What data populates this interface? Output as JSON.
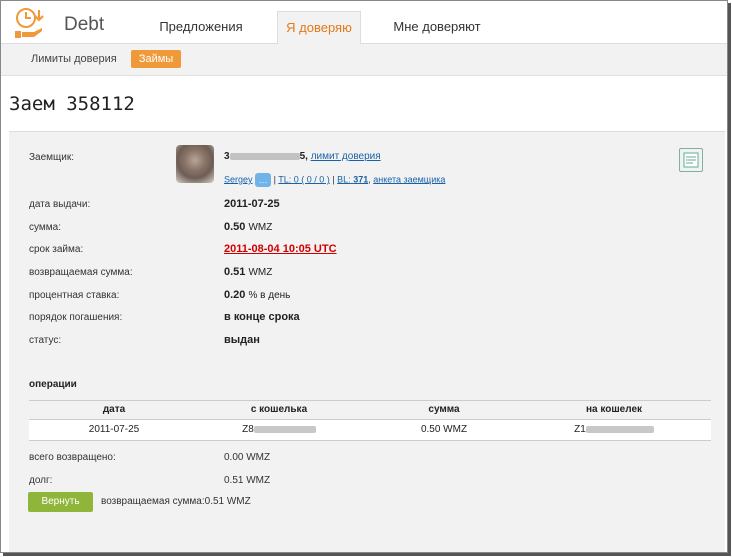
{
  "header": {
    "brand": "Debt",
    "tabs": [
      {
        "label": "Предложения"
      },
      {
        "label": "Я доверяю"
      },
      {
        "label": "Мне доверяют"
      }
    ]
  },
  "subnav": {
    "link_label": "Лимиты доверия",
    "active_label": "Займы"
  },
  "page_title": "Заем 358112",
  "borrower": {
    "label": "Заемщик:",
    "name_prefix": "3",
    "name_suffix": "5,",
    "limit_link": "лимит доверия",
    "user_link": "Sergey",
    "tl_link": "TL: 0 ( 0 / 0 )",
    "bl_prefix": "BL:",
    "bl_value": "371",
    "profile_link": "анкета заемщика"
  },
  "fields": {
    "issue_date": {
      "label": "дата выдачи:",
      "value": "2011-07-25"
    },
    "amount": {
      "label": "сумма:",
      "value": "0.50",
      "unit": "WMZ"
    },
    "term": {
      "label": "срок займа:",
      "value": "2011-08-04 10:05 UTC"
    },
    "return_amount": {
      "label": "возвращаемая сумма:",
      "value": "0.51",
      "unit": "WMZ"
    },
    "rate": {
      "label": "процентная ставка:",
      "value": "0.20",
      "unit": "% в день"
    },
    "repayment": {
      "label": "порядок погашения:",
      "value": "в конце срока"
    },
    "status": {
      "label": "статус:",
      "value": "выдан"
    }
  },
  "operations": {
    "title": "операции",
    "columns": [
      "дата",
      "с кошелька",
      "сумма",
      "на кошелек"
    ],
    "rows": [
      {
        "date": "2011-07-25",
        "from": "Z8",
        "sum": "0.50 WMZ",
        "to": "Z1"
      }
    ]
  },
  "summary": {
    "returned_label": "всего возвращено:",
    "returned_value": "0.00 WMZ",
    "debt_label": "долг:",
    "debt_value": "0.51 WMZ"
  },
  "return_button": "Вернуть",
  "return_text": "возвращаемая сумма:0.51 WMZ",
  "colors": {
    "accent_orange": "#ef9a3a",
    "tab_active_text": "#e07a1b",
    "return_button": "#8fb63a",
    "link": "#1a62a8",
    "danger": "#d00000"
  }
}
